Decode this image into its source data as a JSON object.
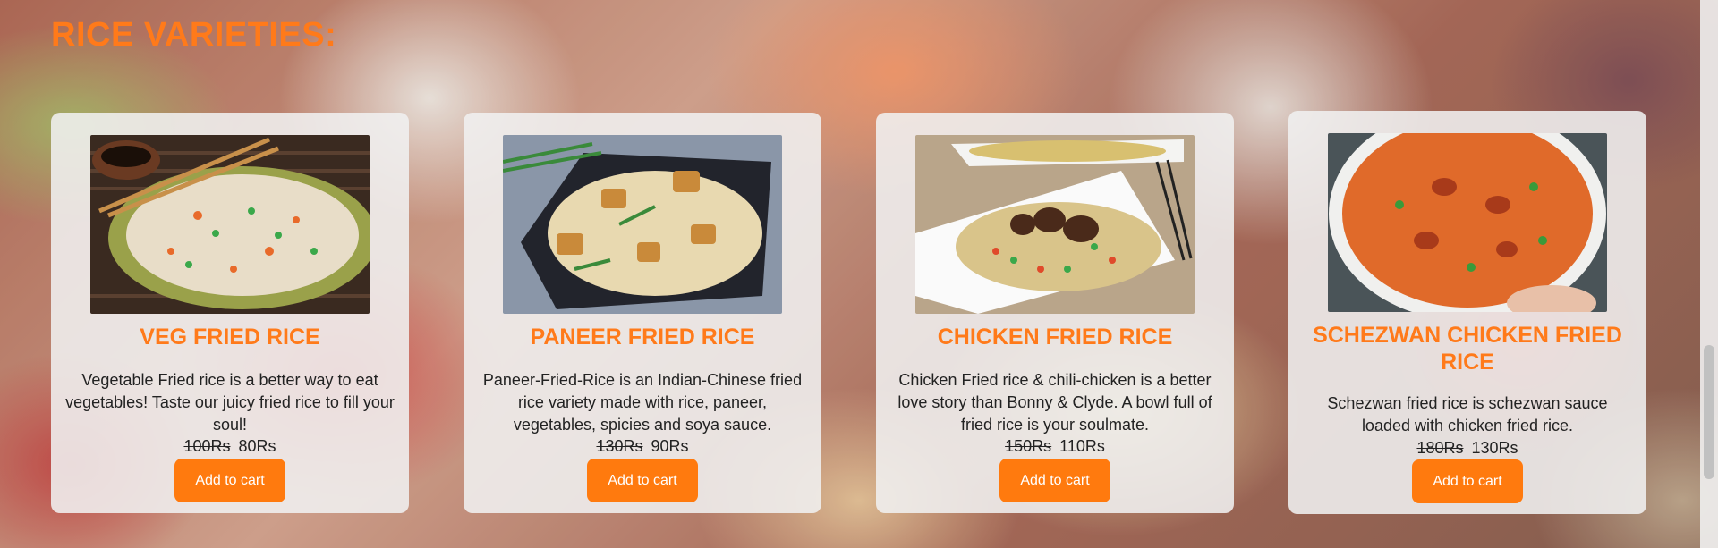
{
  "page": {
    "title": "RICE VARIETIES:"
  },
  "colors": {
    "accent": "#ff7a1a",
    "button": "#ff7a0e"
  },
  "cards": [
    {
      "title": "VEG FRIED RICE",
      "description": "Vegetable Fried rice is a better way to eat vegetables! Taste our juicy fried rice to fill your soul!",
      "old_price": "100Rs",
      "new_price": "80Rs",
      "button": "Add to cart"
    },
    {
      "title": "PANEER FRIED RICE",
      "description": "Paneer-Fried-Rice is an Indian-Chinese fried rice variety made with rice, paneer, vegetables, spicies and soya sauce.",
      "old_price": "130Rs",
      "new_price": "90Rs",
      "button": "Add to cart"
    },
    {
      "title": "CHICKEN FRIED RICE",
      "description": "Chicken Fried rice & chili-chicken is a better love story than Bonny & Clyde. A bowl full of fried rice is your soulmate.",
      "old_price": "150Rs",
      "new_price": "110Rs",
      "button": "Add to cart"
    },
    {
      "title": "SCHEZWAN CHICKEN FRIED RICE",
      "description": "Schezwan fried rice is schezwan sauce loaded with chicken fried rice.",
      "old_price": "180Rs",
      "new_price": "130Rs",
      "button": "Add to cart"
    }
  ]
}
